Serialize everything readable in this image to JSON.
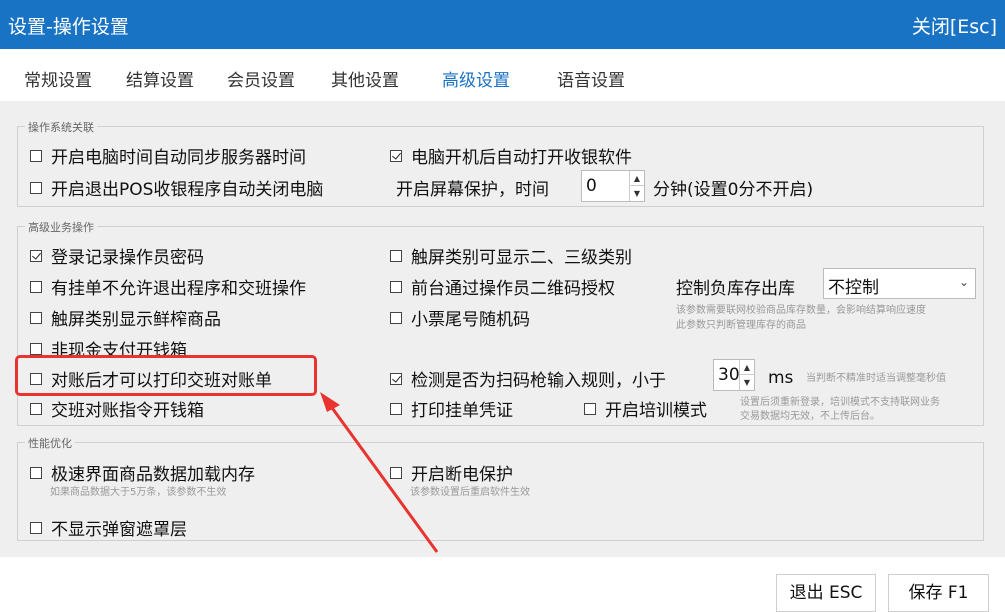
{
  "window": {
    "title": "设置-操作设置",
    "close_label": "关闭[Esc]"
  },
  "tabs": [
    {
      "label": "常规设置",
      "active": false
    },
    {
      "label": "结算设置",
      "active": false
    },
    {
      "label": "会员设置",
      "active": false
    },
    {
      "label": "其他设置",
      "active": false
    },
    {
      "label": "高级设置",
      "active": true
    },
    {
      "label": "语音设置",
      "active": false
    }
  ],
  "os_group": {
    "legend": "操作系统关联",
    "sync_time": {
      "label": "开启电脑时间自动同步服务器时间",
      "checked": false
    },
    "auto_launch": {
      "label": "电脑开机后自动打开收银软件",
      "checked": true
    },
    "auto_shutdown": {
      "label": "开启退出POS收银程序自动关闭电脑",
      "checked": false
    },
    "screensaver": {
      "label": "开启屏幕保护，时间",
      "value": "0",
      "suffix": "分钟(设置0分不开启)"
    }
  },
  "biz_group": {
    "legend": "高级业务操作",
    "login_password": {
      "label": "登录记录操作员密码",
      "checked": true
    },
    "touch_category": {
      "label": "触屏类别可显示二、三级类别",
      "checked": false
    },
    "hang_no_exit": {
      "label": "有挂单不允许退出程序和交班操作",
      "checked": false
    },
    "qr_auth": {
      "label": "前台通过操作员二维码授权",
      "checked": false
    },
    "stock_control": {
      "label": "控制负库存出库",
      "value": "不控制",
      "hint1": "该参数需要联网校验商品库存数量，会影响结算响应速度",
      "hint2": "此参数只判断管理库存的商品"
    },
    "touch_fresh": {
      "label": "触屏类别显示鲜榨商品",
      "checked": false
    },
    "ticket_random": {
      "label": "小票尾号随机码",
      "checked": false
    },
    "noncash_drawer": {
      "label": "非现金支付开钱箱",
      "checked": false
    },
    "print_after_reconcile": {
      "label": "对账后才可以打印交班对账单",
      "checked": false
    },
    "scan_rule": {
      "label": "检测是否为扫码枪输入规则，小于",
      "checked": true,
      "value": "30",
      "unit": "ms",
      "hint": "当判断不精准时适当调整毫秒值"
    },
    "reconcile_drawer": {
      "label": "交班对账指令开钱箱",
      "checked": false
    },
    "print_hang": {
      "label": "打印挂单凭证",
      "checked": false
    },
    "training_mode": {
      "label": "开启培训模式",
      "checked": false,
      "hint1": "设置后须重新登录，培训模式不支持联网业务",
      "hint2": "交易数据均无效，不上传后台。"
    }
  },
  "perf_group": {
    "legend": "性能优化",
    "fast_load": {
      "label": "极速界面商品数据加载内存",
      "checked": false,
      "hint": "如果商品数据大于5万条，该参数不生效"
    },
    "power_protect": {
      "label": "开启断电保护",
      "checked": false,
      "hint": "该参数设置后重启软件生效"
    },
    "hide_mask": {
      "label": "不显示弹窗遮罩层",
      "checked": false
    }
  },
  "footer": {
    "exit_label": "退出 ESC",
    "save_label": "保存 F1"
  },
  "annotation": {
    "box_color": "#e8332f",
    "arrow_color": "#e8332f"
  }
}
